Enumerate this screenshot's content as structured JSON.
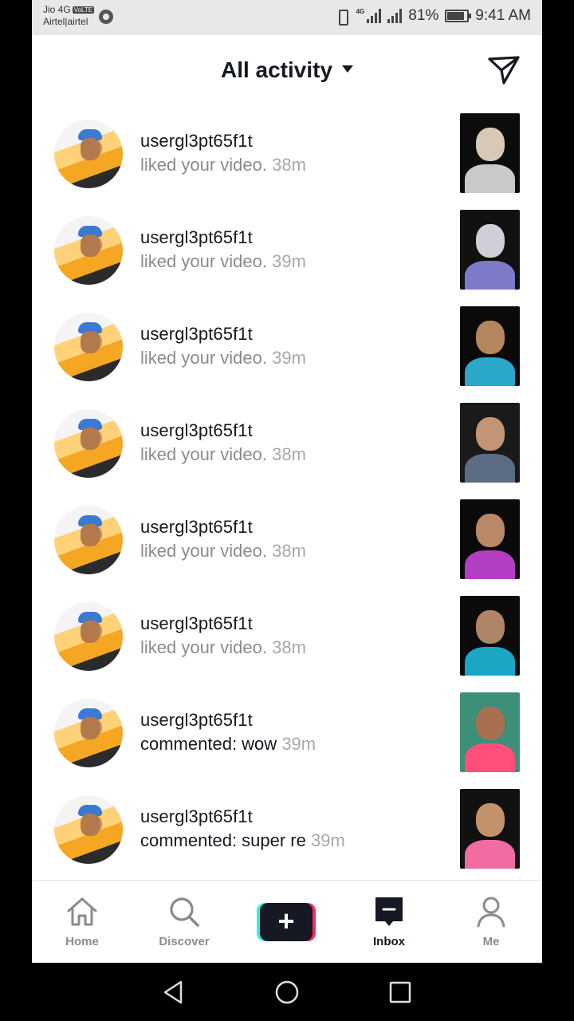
{
  "status_bar": {
    "carrier1": "Jio 4G",
    "volte_badge": "VoLTE",
    "carrier2": "Airtel|airtel",
    "network": "4G",
    "battery": "81%",
    "time": "9:41 AM"
  },
  "header": {
    "title": "All activity"
  },
  "activities": [
    {
      "username": "usergl3pt65f1t",
      "action": "liked your video.",
      "time": "38m",
      "type": "like",
      "thumb_face": "#d8c8b6",
      "thumb_bg": "#0c0c0c",
      "thumb_shirt": "#c9c9c9"
    },
    {
      "username": "usergl3pt65f1t",
      "action": "liked your video.",
      "time": "39m",
      "type": "like",
      "thumb_face": "#cfcfd8",
      "thumb_bg": "#111111",
      "thumb_shirt": "#7d7bc9"
    },
    {
      "username": "usergl3pt65f1t",
      "action": "liked your video.",
      "time": "39m",
      "type": "like",
      "thumb_face": "#b5865e",
      "thumb_bg": "#0a0a0a",
      "thumb_shirt": "#2aa7c9"
    },
    {
      "username": "usergl3pt65f1t",
      "action": "liked your video.",
      "time": "38m",
      "type": "like",
      "thumb_face": "#c29574",
      "thumb_bg": "#1a1a1a",
      "thumb_shirt": "#5b6c84"
    },
    {
      "username": "usergl3pt65f1t",
      "action": "liked your video.",
      "time": "38m",
      "type": "like",
      "thumb_face": "#b88867",
      "thumb_bg": "#0a0a0a",
      "thumb_shirt": "#b23fc2"
    },
    {
      "username": "usergl3pt65f1t",
      "action": "liked your video.",
      "time": "38m",
      "type": "like",
      "thumb_face": "#b08467",
      "thumb_bg": "#0b0b0b",
      "thumb_shirt": "#1aa6c4"
    },
    {
      "username": "usergl3pt65f1t",
      "action": "commented: wow",
      "time": "39m",
      "type": "comment",
      "thumb_face": "#a86f50",
      "thumb_bg": "#3d8f78",
      "thumb_shirt": "#ff4f7b"
    },
    {
      "username": "usergl3pt65f1t",
      "action": "commented: super re",
      "time": "39m",
      "type": "comment",
      "thumb_face": "#c3926c",
      "thumb_bg": "#111111",
      "thumb_shirt": "#f06ca2"
    }
  ],
  "bottom_nav": {
    "home": "Home",
    "discover": "Discover",
    "create": "+",
    "inbox": "Inbox",
    "me": "Me"
  },
  "colors": {
    "text_primary": "#161823",
    "text_secondary": "#8a8b91",
    "create_cyan": "#25f4ee",
    "create_pink": "#fe2c55"
  }
}
